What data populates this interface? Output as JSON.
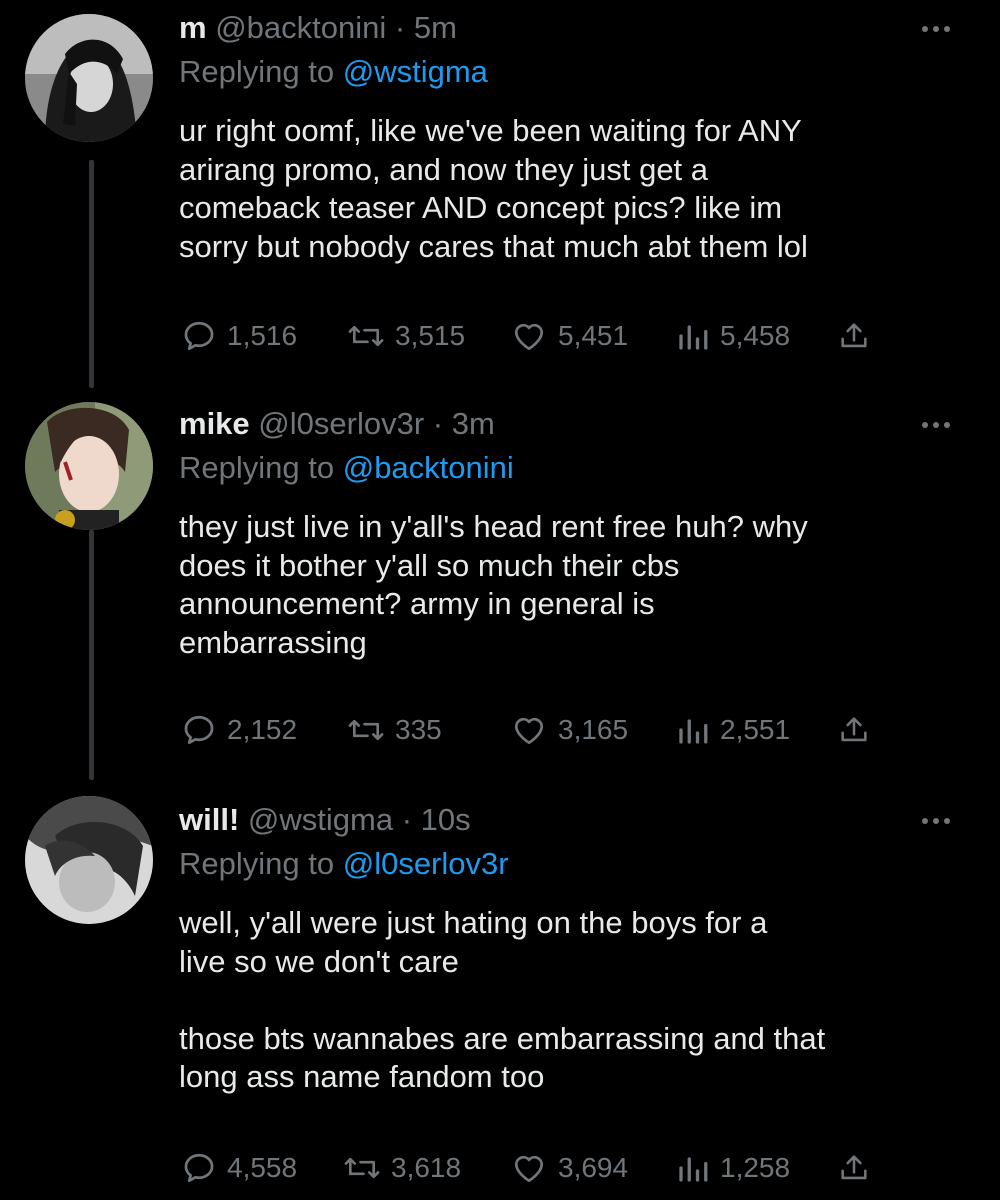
{
  "tweets": [
    {
      "name": "m",
      "handle": "@backtonini",
      "dot": "·",
      "time": "5m",
      "replying_prefix": "Replying to",
      "replying_to": "@wstigma",
      "text": "ur right oomf, like we've been waiting for ANY\narirang promo, and now they just get a\ncomeback teaser AND concept pics? like im\nsorry but nobody cares that much abt them lol",
      "replies": "1,516",
      "retweets": "3,515",
      "likes": "5,451",
      "views": "5,458"
    },
    {
      "name": "mike",
      "handle": "@l0serlov3r",
      "dot": "·",
      "time": "3m",
      "replying_prefix": "Replying to",
      "replying_to": "@backtonini",
      "text": "they just live in y'all's head rent free huh? why\ndoes it bother y'all so much their cbs\nannouncement? army in general is\nembarrassing",
      "replies": "2,152",
      "retweets": "335",
      "likes": "3,165",
      "views": "2,551"
    },
    {
      "name": "will!",
      "handle": "@wstigma",
      "dot": "·",
      "time": "10s",
      "replying_prefix": "Replying to",
      "replying_to": "@l0serlov3r",
      "text": "well, y'all were just hating on the boys for a\nlive so we don't care\n\nthose bts wannabes are embarrassing and that\nlong ass name fandom too",
      "replies": "4,558",
      "retweets": "3,618",
      "likes": "3,694",
      "views": "1,258"
    }
  ],
  "colors": {
    "background": "#000000",
    "text": "#e7e9ea",
    "secondary": "#71767b",
    "link": "#1d9bf0",
    "thread_line": "#333639"
  }
}
